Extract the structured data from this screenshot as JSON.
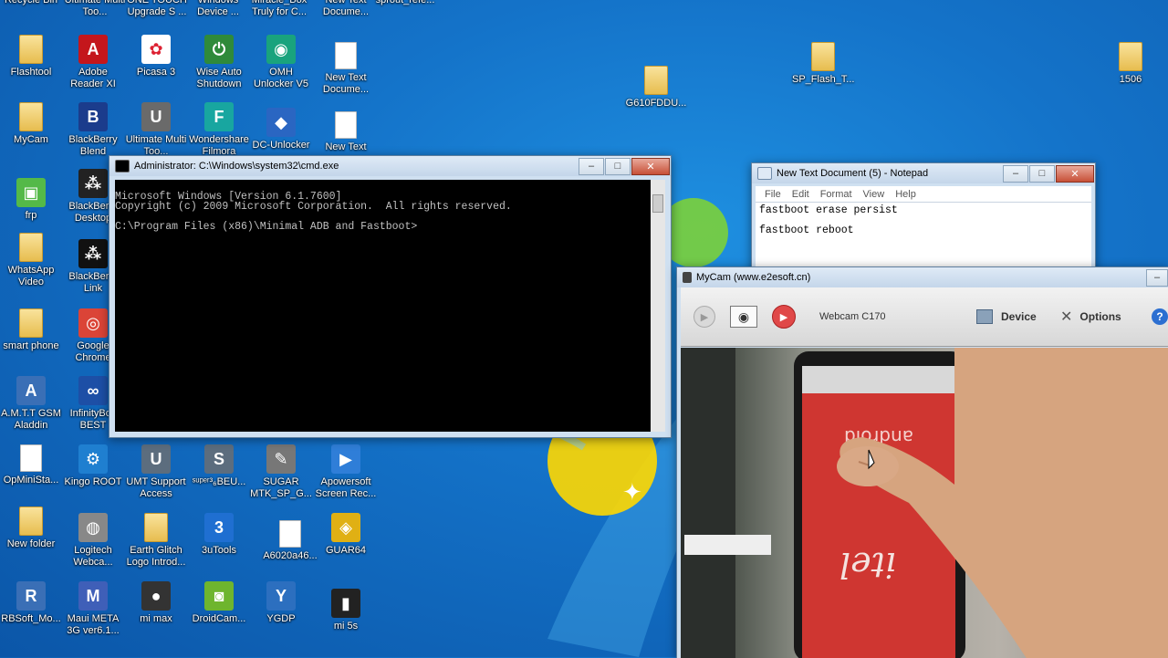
{
  "desktop": {
    "top_row": [
      "Recycle Bin",
      "Ultimate Multi Too...",
      "ONE TOUCH Upgrade S ...",
      "Windows Device ...",
      "Miracle_Box Truly for C...",
      "New Text Docume...",
      "sprout_refe..."
    ],
    "icons": [
      {
        "label": "Flashtool",
        "kind": "folder"
      },
      {
        "label": "Adobe Reader XI",
        "kind": "app",
        "color": "#c4161c",
        "glyph": "A"
      },
      {
        "label": "Picasa 3",
        "kind": "app",
        "color": "#ffffff",
        "glyph": "✿"
      },
      {
        "label": "Wise Auto Shutdown",
        "kind": "app",
        "color": "#2f8a3a",
        "glyph": "⏻"
      },
      {
        "label": "OMH Unlocker V5",
        "kind": "app",
        "color": "#19a37d",
        "glyph": "◉"
      },
      {
        "label": "New Text Docume...",
        "kind": "doc"
      },
      {
        "label": "G610FDDU...",
        "kind": "folder"
      },
      {
        "label": "SP_Flash_T...",
        "kind": "folder"
      },
      {
        "label": "1506",
        "kind": "folder"
      },
      {
        "label": "MyCam",
        "kind": "folder"
      },
      {
        "label": "BlackBerry Blend",
        "kind": "app",
        "color": "#1b3c8c",
        "glyph": "B"
      },
      {
        "label": "Ultimate Multi Too...",
        "kind": "app",
        "color": "#6a6a6a",
        "glyph": "U"
      },
      {
        "label": "Wondershare Filmora",
        "kind": "app",
        "color": "#18a6a0",
        "glyph": "F"
      },
      {
        "label": "DC-Unlocker",
        "kind": "app",
        "color": "#2a66c2",
        "glyph": "◆"
      },
      {
        "label": "New Text",
        "kind": "doc"
      },
      {
        "label": "frp",
        "kind": "app",
        "color": "#54b948",
        "glyph": "▣"
      },
      {
        "label": "BlackBerry Desktop",
        "kind": "app",
        "color": "#222222",
        "glyph": "⁂"
      },
      {
        "label": "WhatsApp Video",
        "kind": "folder"
      },
      {
        "label": "BlackBerry Link",
        "kind": "app",
        "color": "#111111",
        "glyph": "⁂"
      },
      {
        "label": "smart phone",
        "kind": "folder"
      },
      {
        "label": "Google Chrome",
        "kind": "app",
        "color": "#db4437",
        "glyph": "◎"
      },
      {
        "label": "A.M.T.T GSM Aladdin",
        "kind": "app",
        "color": "#3a6fb6",
        "glyph": "A"
      },
      {
        "label": "InfinityBox BEST",
        "kind": "app",
        "color": "#1d4fa6",
        "glyph": "∞"
      },
      {
        "label": "OpMiniSta...",
        "kind": "doc"
      },
      {
        "label": "Kingo ROOT",
        "kind": "app",
        "color": "#1f7fd0",
        "glyph": "⚙"
      },
      {
        "label": "UMT Support Access",
        "kind": "app",
        "color": "#5c6d7e",
        "glyph": "U"
      },
      {
        "label": "ˢᵘᵖᵉʳ³₆BEU...",
        "kind": "app",
        "color": "#5c6d7e",
        "glyph": "S"
      },
      {
        "label": "SUGAR MTK_SP_G...",
        "kind": "app",
        "color": "#777777",
        "glyph": "✎"
      },
      {
        "label": "Apowersoft Screen Rec...",
        "kind": "app",
        "color": "#2f7ed8",
        "glyph": "▶"
      },
      {
        "label": "New folder",
        "kind": "folder"
      },
      {
        "label": "Logitech Webca...",
        "kind": "app",
        "color": "#888888",
        "glyph": "◍"
      },
      {
        "label": "Earth Glitch Logo Introd...",
        "kind": "folder"
      },
      {
        "label": "3uTools",
        "kind": "app",
        "color": "#1f6fd1",
        "glyph": "3"
      },
      {
        "label": "A6020a46...",
        "kind": "doc"
      },
      {
        "label": "GUAR64",
        "kind": "app",
        "color": "#e0b014",
        "glyph": "◈"
      },
      {
        "label": "RBSoft_Mo...",
        "kind": "app",
        "color": "#3a6fb6",
        "glyph": "R"
      },
      {
        "label": "Maui META 3G ver6.1...",
        "kind": "app",
        "color": "#3f5fb8",
        "glyph": "M"
      },
      {
        "label": "mi max",
        "kind": "app",
        "color": "#333333",
        "glyph": "●"
      },
      {
        "label": "DroidCam...",
        "kind": "app",
        "color": "#6eb52e",
        "glyph": "◙"
      },
      {
        "label": "YGDP",
        "kind": "app",
        "color": "#2c6fbf",
        "glyph": "Y"
      },
      {
        "label": "mi 5s",
        "kind": "app",
        "color": "#222222",
        "glyph": "▮"
      }
    ]
  },
  "cmd": {
    "title": "Administrator: C:\\Windows\\system32\\cmd.exe",
    "lines": [
      "Microsoft Windows [Version 6.1.7600]",
      "Copyright (c) 2009 Microsoft Corporation.  All rights reserved.",
      "",
      "C:\\Program Files (x86)\\Minimal ADB and Fastboot>"
    ]
  },
  "notepad": {
    "title": "New Text Document (5) - Notepad",
    "menu": [
      "File",
      "Edit",
      "Format",
      "View",
      "Help"
    ],
    "lines": [
      "fastboot erase persist",
      "fastboot reboot"
    ]
  },
  "mycam": {
    "title": "MyCam (www.e2esoft.cn)",
    "source": "Webcam C170",
    "device_label": "Device",
    "options_label": "Options",
    "help_label": "?",
    "phone_screen_text": "android",
    "phone_brand_text": "itel"
  }
}
